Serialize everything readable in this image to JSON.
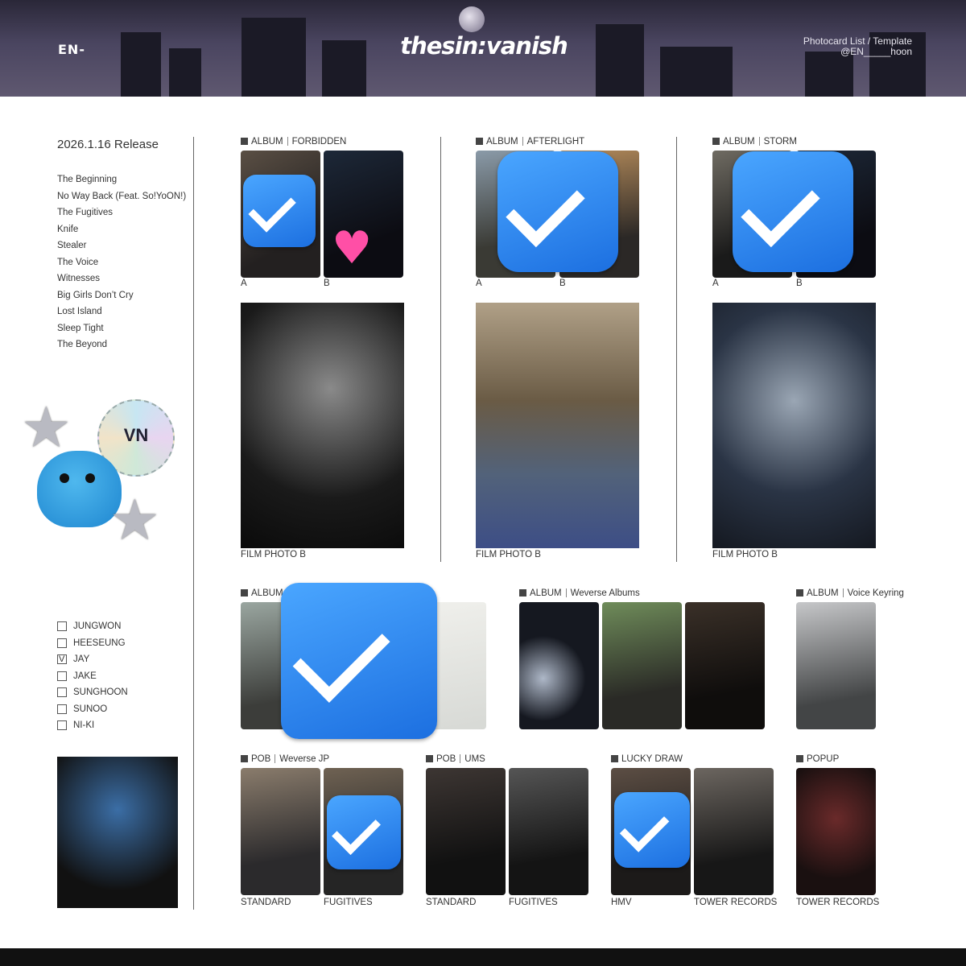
{
  "header": {
    "logo": "EN-",
    "title": "thesin:vanish",
    "note_line1": "Photocard List / Template",
    "note_line2": "@EN_____hoon"
  },
  "sidebar": {
    "release": "2026.1.16 Release",
    "tracks": [
      "The Beginning",
      "No Way Back (Feat. So!YoON!)",
      "The Fugitives",
      "Knife",
      "Stealer",
      "The Voice",
      "Witnesses",
      "Big Girls Don’t Cry",
      "Lost Island",
      "Sleep Tight",
      "The Beyond"
    ],
    "seal_text": "VN",
    "members": [
      {
        "name": "JUNGWON",
        "checked": false
      },
      {
        "name": "HEESEUNG",
        "checked": false
      },
      {
        "name": "JAY",
        "checked": true
      },
      {
        "name": "JAKE",
        "checked": false
      },
      {
        "name": "SUNGHOON",
        "checked": false
      },
      {
        "name": "SUNOO",
        "checked": false
      },
      {
        "name": "NI-KI",
        "checked": false
      }
    ]
  },
  "sections": {
    "forbidden": {
      "type": "ALBUM",
      "name": "FORBIDDEN",
      "cap_a": "A",
      "cap_b": "B",
      "film": "FILM PHOTO B"
    },
    "afterlight": {
      "type": "ALBUM",
      "name": "AFTERLIGHT",
      "cap_a": "A",
      "cap_b": "B",
      "film": "FILM PHOTO B"
    },
    "storm": {
      "type": "ALBUM",
      "name": "STORM",
      "cap_a": "A",
      "cap_b": "B",
      "film": "FILM PHOTO B"
    },
    "album4": {
      "type": "ALBUM"
    },
    "weverse_albums": {
      "type": "ALBUM",
      "name": "Weverse Albums"
    },
    "voice_keyring": {
      "type": "ALBUM",
      "name": "Voice Keyring"
    },
    "pob_weverse_jp": {
      "type": "POB",
      "name": "Weverse JP",
      "cap_a": "STANDARD",
      "cap_b": "FUGITIVES"
    },
    "pob_ums": {
      "type": "POB",
      "name": "UMS",
      "cap_a": "STANDARD",
      "cap_b": "FUGITIVES"
    },
    "lucky_draw": {
      "type": "LUCKY DRAW",
      "cap_a": "HMV",
      "cap_b": "TOWER RECORDS"
    },
    "popup": {
      "type": "POPUP",
      "cap_a": "TOWER RECORDS"
    }
  },
  "icons": {
    "checkmark": "check-badge-icon",
    "heart": "sparkling-heart-icon",
    "star": "chrome-star-icon"
  },
  "colors": {
    "check_blue": "#1c6fe0",
    "header_bg": "#3a3650"
  }
}
